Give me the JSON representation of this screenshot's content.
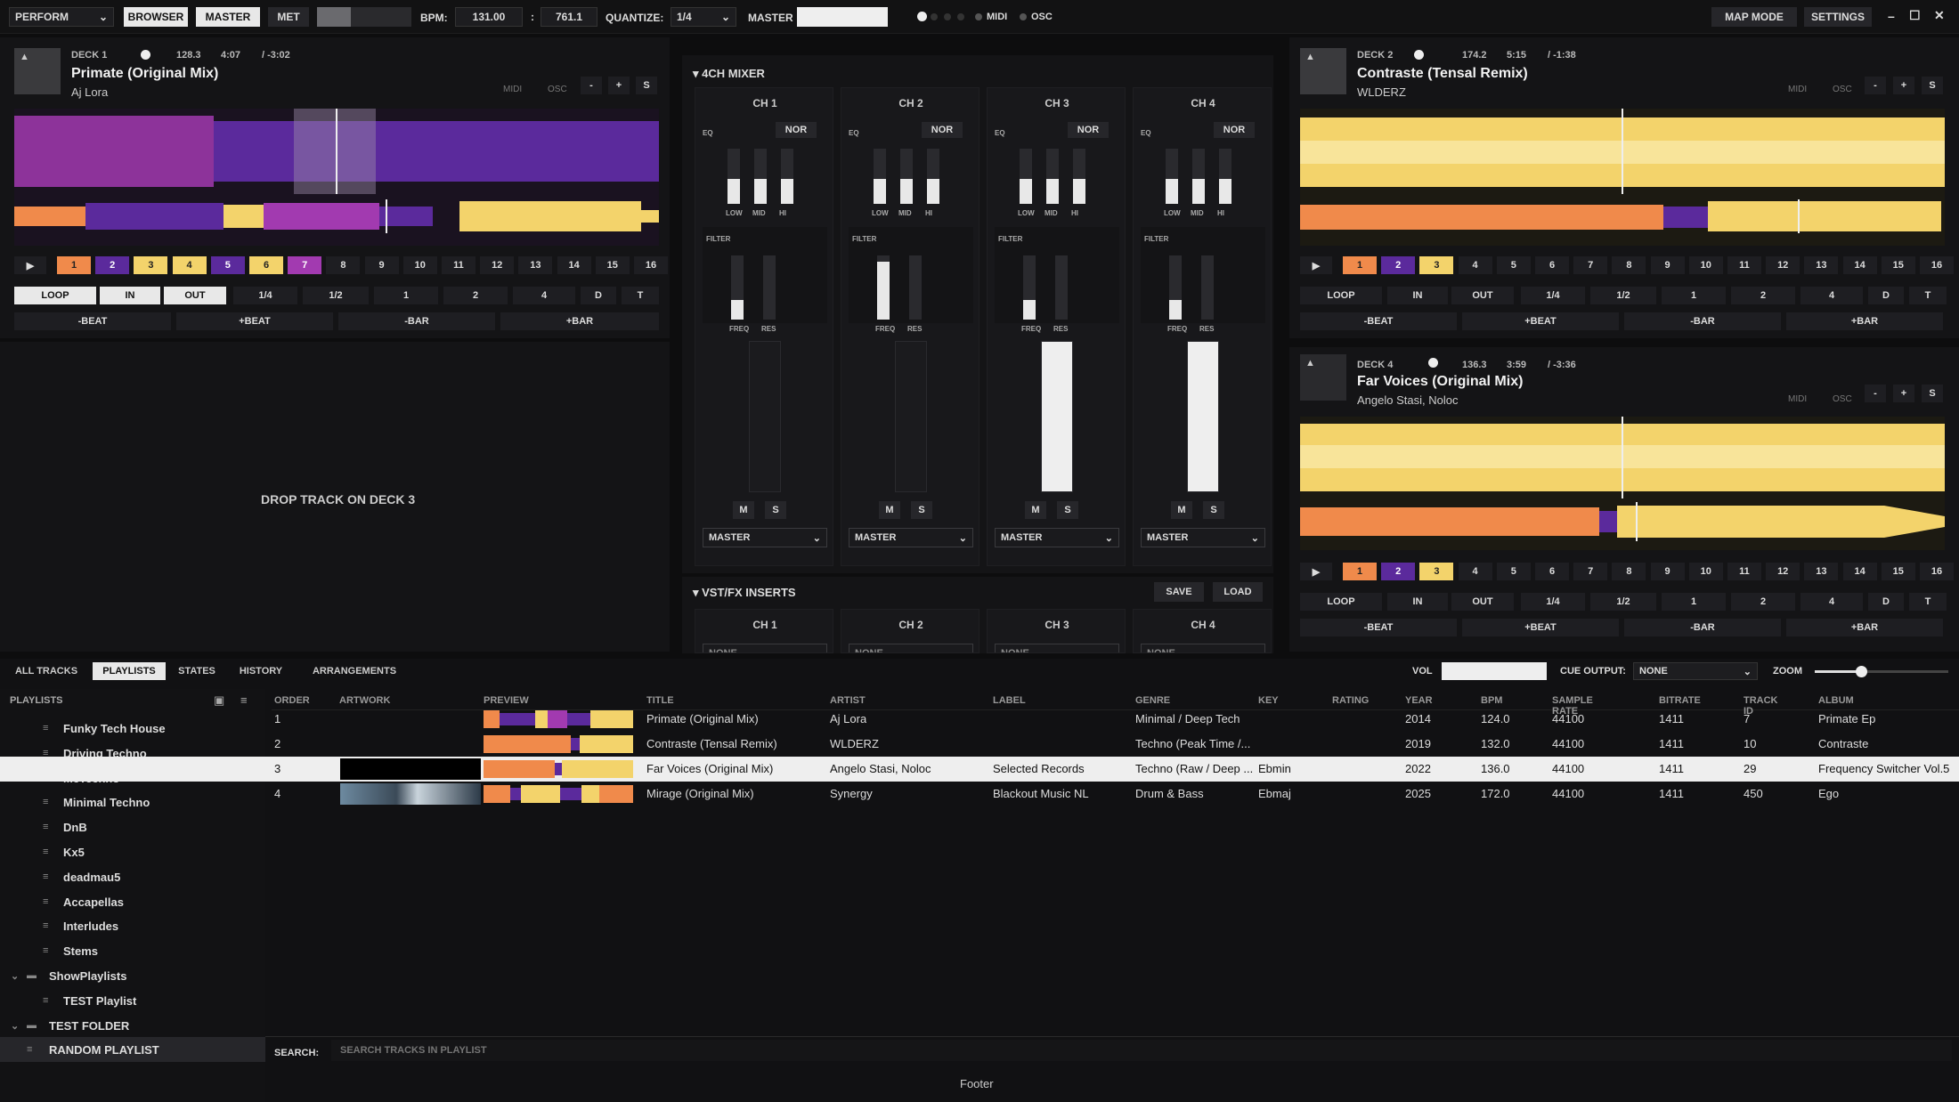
{
  "topbar": {
    "mode": "PERFORM",
    "browser": "BROWSER",
    "master": "MASTER",
    "met": "MET",
    "bpm_label": "BPM:",
    "bpm": "131.00",
    "colon": ":",
    "pitch": "761.1",
    "quantize_label": "QUANTIZE:",
    "quantize": "1/4",
    "master_label": "MASTER",
    "midi": "MIDI",
    "osc": "OSC",
    "map_mode": "MAP MODE",
    "settings": "SETTINGS",
    "min": "–",
    "max": "☐",
    "close": "✕"
  },
  "deck1": {
    "name": "DECK 1",
    "bpm": "128.3",
    "time": "4:07",
    "remain": "/ -3:02",
    "title": "Primate (Original Mix)",
    "artist": "Aj Lora",
    "midi": "MIDI",
    "osc": "OSC",
    "minus": "-",
    "plus": "+",
    "s": "S"
  },
  "deck2": {
    "name": "DECK 2",
    "bpm": "174.2",
    "time": "5:15",
    "remain": "/ -1:38",
    "title": "Contraste (Tensal Remix)",
    "artist": "WLDERZ",
    "midi": "MIDI",
    "osc": "OSC",
    "minus": "-",
    "plus": "+",
    "s": "S"
  },
  "deck4": {
    "name": "DECK 4",
    "bpm": "136.3",
    "time": "3:59",
    "remain": "/ -3:36",
    "title": "Far Voices (Original Mix)",
    "artist": "Angelo Stasi, Noloc",
    "midi": "MIDI",
    "osc": "OSC",
    "minus": "-",
    "plus": "+",
    "s": "S"
  },
  "deck3": {
    "drop": "DROP TRACK ON DECK 3"
  },
  "hotcues": [
    "1",
    "2",
    "3",
    "4",
    "5",
    "6",
    "7",
    "8",
    "9",
    "10",
    "11",
    "12",
    "13",
    "14",
    "15",
    "16"
  ],
  "controls": {
    "loop": "LOOP",
    "in": "IN",
    "out": "OUT",
    "q": "1/4",
    "h": "1/2",
    "one": "1",
    "two": "2",
    "four": "4",
    "d": "D",
    "t": "T",
    "mbeat": "-BEAT",
    "pbeat": "+BEAT",
    "mbar": "-BAR",
    "pbar": "+BAR"
  },
  "mixer": {
    "title": "4CH MIXER",
    "eq": "EQ",
    "nor": "NOR",
    "low": "LOW",
    "mid": "MID",
    "hi": "HI",
    "filter": "FILTER",
    "freq": "FREQ",
    "res": "RES",
    "m": "M",
    "s": "S",
    "output": "MASTER",
    "channels": [
      "CH 1",
      "CH 2",
      "CH 3",
      "CH 4"
    ]
  },
  "vst": {
    "title": "VST/FX INSERTS",
    "save": "SAVE",
    "load": "LOAD",
    "channels": [
      "CH 1",
      "CH 2",
      "CH 3",
      "CH 4"
    ],
    "none": "NONE"
  },
  "browser": {
    "tabs": [
      "ALL TRACKS",
      "PLAYLISTS",
      "STATES",
      "HISTORY",
      "ARRANGEMENTS"
    ],
    "vol": "VOL",
    "cue_label": "CUE OUTPUT:",
    "cue": "NONE",
    "zoom": "ZOOM",
    "search_label": "SEARCH:",
    "search_placeholder": "SEARCH TRACKS IN PLAYLIST",
    "footer": "Footer",
    "columns": {
      "playlists": "PLAYLISTS",
      "order": "ORDER",
      "artwork": "ARTWORK",
      "preview": "PREVIEW",
      "title": "TITLE",
      "artist": "ARTIST",
      "label": "LABEL",
      "genre": "GENRE",
      "key": "KEY",
      "rating": "RATING",
      "year": "YEAR",
      "bpm": "BPM",
      "sample_rate": "SAMPLE RATE",
      "bitrate": "BITRATE",
      "track_id": "TRACK ID",
      "album": "ALBUM"
    }
  },
  "playlists": [
    {
      "name": "Funky Tech House"
    },
    {
      "name": "Driving Techno"
    },
    {
      "name": "McTechno"
    },
    {
      "name": "Minimal Techno"
    },
    {
      "name": "DnB"
    },
    {
      "name": "Kx5"
    },
    {
      "name": "deadmau5"
    },
    {
      "name": "Accapellas"
    },
    {
      "name": "Interludes"
    },
    {
      "name": "Stems"
    },
    {
      "name": "ShowPlaylists"
    },
    {
      "name": "TEST Playlist"
    },
    {
      "name": "TEST FOLDER"
    },
    {
      "name": "RANDOM PLAYLIST"
    }
  ],
  "tracks": [
    {
      "order": "1",
      "title": "Primate (Original Mix)",
      "artist": "Aj Lora",
      "label": "",
      "genre": "Minimal / Deep Tech",
      "key": "",
      "year": "2014",
      "bpm": "124.0",
      "sr": "44100",
      "bitrate": "1411",
      "id": "7",
      "album": "Primate Ep"
    },
    {
      "order": "2",
      "title": "Contraste (Tensal Remix)",
      "artist": "WLDERZ",
      "label": "",
      "genre": "Techno (Peak Time /...",
      "key": "",
      "year": "2019",
      "bpm": "132.0",
      "sr": "44100",
      "bitrate": "1411",
      "id": "10",
      "album": "Contraste"
    },
    {
      "order": "3",
      "title": "Far Voices (Original Mix)",
      "artist": "Angelo Stasi, Noloc",
      "label": "Selected Records",
      "genre": "Techno (Raw / Deep ...",
      "key": "Ebmin",
      "year": "2022",
      "bpm": "136.0",
      "sr": "44100",
      "bitrate": "1411",
      "id": "29",
      "album": "Frequency Switcher Vol.5"
    },
    {
      "order": "4",
      "title": "Mirage (Original Mix)",
      "artist": "Synergy",
      "label": "Blackout Music NL",
      "genre": "Drum & Bass",
      "key": "Ebmaj",
      "year": "2025",
      "bpm": "172.0",
      "sr": "44100",
      "bitrate": "1411",
      "id": "450",
      "album": "Ego"
    }
  ],
  "colors": {
    "orange": "#f08a4b",
    "purple": "#5b2a9c",
    "yellow": "#f3d36b",
    "magenta": "#a23ab0"
  }
}
